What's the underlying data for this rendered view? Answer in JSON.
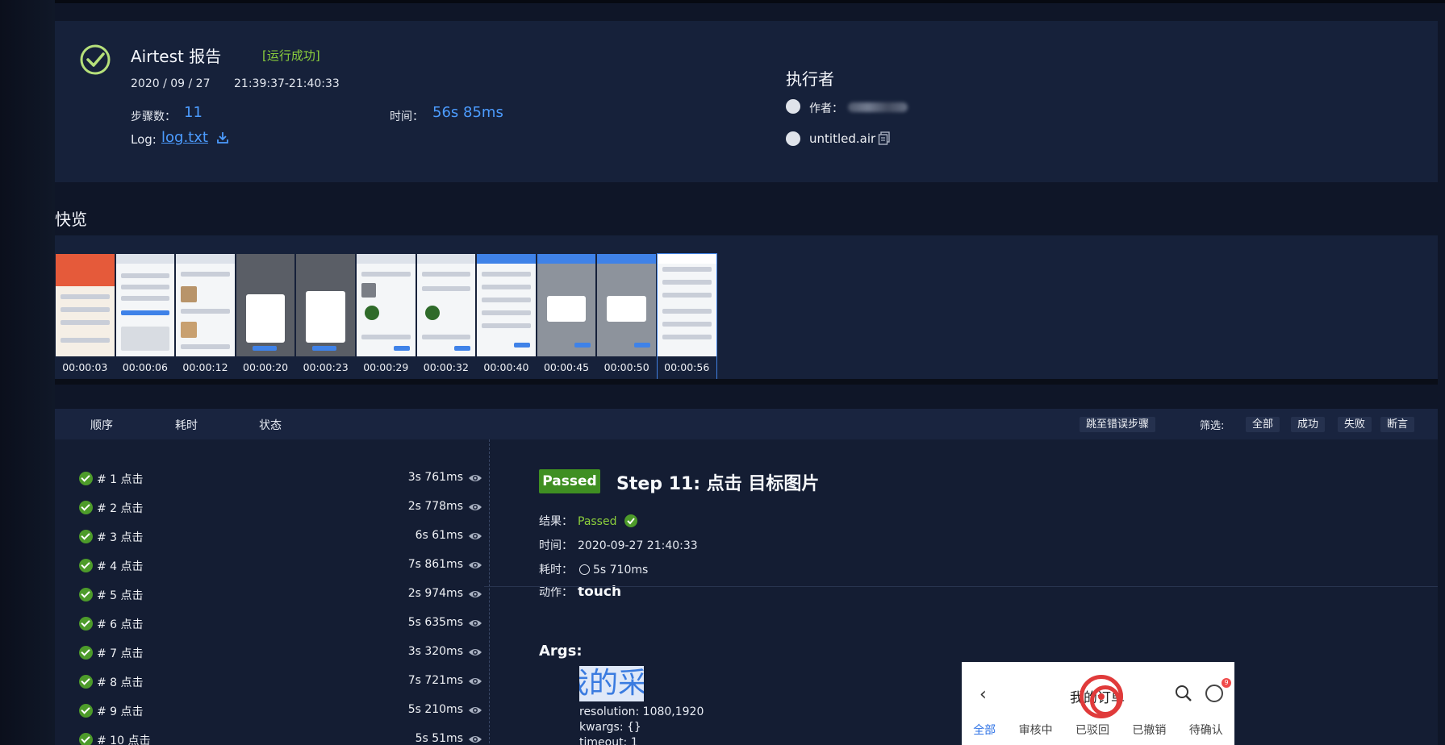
{
  "summary": {
    "title": "Airtest 报告",
    "status": "[运行成功]",
    "date": "2020 / 09 / 27",
    "time_range": "21:39:37-21:40:33",
    "steps_label": "步骤数：",
    "steps_count": "11",
    "time_label": "时间：",
    "total_time": "56s 85ms",
    "log_label": "Log:",
    "log_file": "log.txt",
    "executor_title": "执行者",
    "author_label": "作者：",
    "script_name": "untitled.air"
  },
  "quickview": {
    "title": "快览",
    "thumbs": [
      "00:00:03",
      "00:00:06",
      "00:00:12",
      "00:00:20",
      "00:00:23",
      "00:00:29",
      "00:00:32",
      "00:00:40",
      "00:00:45",
      "00:00:50",
      "00:00:56"
    ]
  },
  "steps_header": {
    "order": "顺序",
    "duration": "耗时",
    "status": "状态",
    "jump_error": "跳至错误步骤",
    "filter_label": "筛选:",
    "filter_all": "全部",
    "filter_success": "成功",
    "filter_fail": "失败",
    "filter_assert": "断言"
  },
  "steps": [
    {
      "name": "# 1 点击",
      "duration": "3s 761ms"
    },
    {
      "name": "# 2 点击",
      "duration": "2s 778ms"
    },
    {
      "name": "# 3 点击",
      "duration": "6s 61ms"
    },
    {
      "name": "# 4 点击",
      "duration": "7s 861ms"
    },
    {
      "name": "# 5 点击",
      "duration": "2s 974ms"
    },
    {
      "name": "# 6 点击",
      "duration": "5s 635ms"
    },
    {
      "name": "# 7 点击",
      "duration": "3s 320ms"
    },
    {
      "name": "# 8 点击",
      "duration": "7s 721ms"
    },
    {
      "name": "# 9 点击",
      "duration": "5s 210ms"
    },
    {
      "name": "# 10 点击",
      "duration": "5s 51ms"
    }
  ],
  "detail": {
    "badge": "Passed",
    "title": "Step 11: 点击 目标图片",
    "result_label": "结果：",
    "result_value": "Passed",
    "time_label": "时间：",
    "time_value": "2020-09-27 21:40:33",
    "duration_label": "耗时：",
    "duration_value": "5s 710ms",
    "action_label": "动作：",
    "action_value": "touch",
    "args_title": "Args:",
    "crop_text": "我的采",
    "resolution": "resolution: 1080,1920",
    "kwargs": "kwargs: {}",
    "timeout": "timeout: 1"
  },
  "phone": {
    "back": "‹",
    "title": "我的订单",
    "badge": "9",
    "tabs": [
      "全部",
      "审核中",
      "已驳回",
      "已撤销",
      "待确认"
    ]
  },
  "colors": {
    "accent_blue": "#4c9cff",
    "success_green": "#8ccf3c",
    "badge_green": "#3f8f22"
  }
}
